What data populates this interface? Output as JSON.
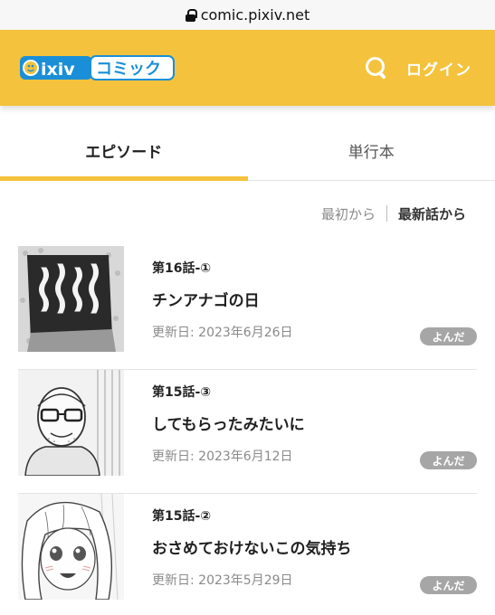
{
  "browser": {
    "url": "comic.pixiv.net"
  },
  "header": {
    "logo_text": "pixivコミック",
    "login_label": "ログイン"
  },
  "tabs": [
    {
      "label": "エピソード",
      "active": true
    },
    {
      "label": "単行本",
      "active": false
    }
  ],
  "sort": {
    "oldest_label": "最初から",
    "newest_label": "最新話から"
  },
  "episodes": [
    {
      "number": "第16話-①",
      "title": "チンアナゴの日",
      "date": "更新日: 2023年6月26日",
      "badge": "よんだ"
    },
    {
      "number": "第15話-③",
      "title": "してもらったみたいに",
      "date": "更新日: 2023年6月12日",
      "badge": "よんだ"
    },
    {
      "number": "第15話-②",
      "title": "おさめておけないこの気持ち",
      "date": "更新日: 2023年5月29日",
      "badge": "よんだ"
    }
  ],
  "colors": {
    "brand_yellow": "#f4c23c",
    "brand_blue": "#1a8fd8",
    "badge_gray": "#a6a6a6"
  }
}
